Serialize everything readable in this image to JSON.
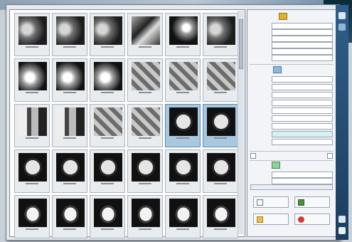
{
  "gallery": {
    "thumbnails": [
      {
        "caption": "",
        "kind": "xray"
      },
      {
        "caption": "",
        "kind": "xray"
      },
      {
        "caption": "",
        "kind": "xray"
      },
      {
        "caption": "",
        "kind": "mixed"
      },
      {
        "caption": "",
        "kind": "dark-mixed"
      },
      {
        "caption": "",
        "kind": "xray"
      },
      {
        "caption": "",
        "kind": "bright"
      },
      {
        "caption": "",
        "kind": "bright"
      },
      {
        "caption": "",
        "kind": "bright"
      },
      {
        "caption": "",
        "kind": "gray"
      },
      {
        "caption": "",
        "kind": "gray"
      },
      {
        "caption": "",
        "kind": "gray"
      },
      {
        "caption": "",
        "kind": "patch"
      },
      {
        "caption": "",
        "kind": "patch"
      },
      {
        "caption": "",
        "kind": "gray"
      },
      {
        "caption": "",
        "kind": "gray"
      },
      {
        "caption": "",
        "kind": "ct",
        "selected": true
      },
      {
        "caption": "",
        "kind": "ct",
        "selected": true
      },
      {
        "caption": "",
        "kind": "ct"
      },
      {
        "caption": "",
        "kind": "ct"
      },
      {
        "caption": "",
        "kind": "ct"
      },
      {
        "caption": "",
        "kind": "ct"
      },
      {
        "caption": "",
        "kind": "ct"
      },
      {
        "caption": "",
        "kind": "ct"
      },
      {
        "caption": "",
        "kind": "ct2"
      },
      {
        "caption": "",
        "kind": "ct2"
      },
      {
        "caption": "",
        "kind": "ct2"
      },
      {
        "caption": "",
        "kind": "ct2"
      },
      {
        "caption": "",
        "kind": "ct2"
      },
      {
        "caption": "",
        "kind": "ct2"
      }
    ]
  },
  "panel": {
    "patient_section_title": "",
    "patient_rows": [
      {
        "label": "",
        "value": ""
      },
      {
        "label": "",
        "value": ""
      },
      {
        "label": "",
        "value": ""
      },
      {
        "label": "",
        "value": ""
      },
      {
        "label": "",
        "value": ""
      },
      {
        "label": "",
        "value": ""
      }
    ],
    "study_section_title": "",
    "study_rows": [
      {
        "label": "",
        "value": ""
      },
      {
        "label": "",
        "value": ""
      },
      {
        "label": "",
        "value": ""
      },
      {
        "label": "",
        "value": ""
      },
      {
        "label": "",
        "value": ""
      },
      {
        "label": "",
        "value": ""
      },
      {
        "label": "",
        "value": ""
      },
      {
        "label": "",
        "value": ""
      },
      {
        "label": "",
        "value": ""
      }
    ],
    "options_section_title": "",
    "option_rows": [
      {
        "label": "",
        "value": ""
      },
      {
        "label": "",
        "value": ""
      }
    ],
    "buttons": [
      {
        "label": "",
        "icon": "document-icon"
      },
      {
        "label": "",
        "icon": "gallery-icon"
      },
      {
        "label": "",
        "icon": "folder-icon"
      },
      {
        "label": "",
        "icon": "stop-icon"
      }
    ]
  },
  "sidebar": {
    "brand": ""
  },
  "colors": {
    "selected_bg": "#a9c7df",
    "sidebar": "#2e5f8a",
    "section_icon": "#e1b02b"
  }
}
